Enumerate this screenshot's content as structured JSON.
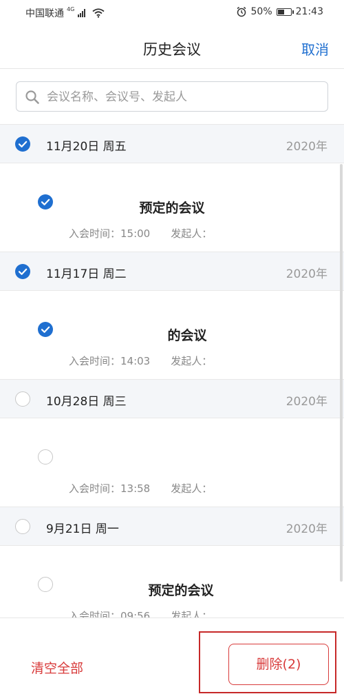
{
  "status_bar": {
    "carrier": "中国联通",
    "network": "4G",
    "battery": "50%",
    "battery_level": 0.5,
    "time": "21:43"
  },
  "header": {
    "title": "历史会议",
    "cancel_label": "取消"
  },
  "search": {
    "placeholder": "会议名称、会议号、发起人",
    "value": ""
  },
  "groups": [
    {
      "date": "11月20日 周五",
      "year": "2020年",
      "checked": true,
      "meeting": {
        "title": "预定的会议",
        "join_time": "入会时间：15:00",
        "initiator": "发起人：",
        "checked": true
      }
    },
    {
      "date": "11月17日 周二",
      "year": "2020年",
      "checked": true,
      "meeting": {
        "title": "的会议",
        "join_time": "入会时间：14:03",
        "initiator": "发起人：",
        "checked": true
      }
    },
    {
      "date": "10月28日 周三",
      "year": "2020年",
      "checked": false,
      "meeting": {
        "title": "",
        "join_time": "入会时间：13:58",
        "initiator": "发起人：",
        "checked": false
      }
    },
    {
      "date": "9月21日 周一",
      "year": "2020年",
      "checked": false,
      "meeting": {
        "title": "预定的会议",
        "join_time": "入会时间：09:56",
        "initiator": "发起人：",
        "checked": false
      }
    }
  ],
  "footer": {
    "clear_all_label": "清空全部",
    "delete_label": "删除(2)"
  },
  "colors": {
    "accent": "#1f6fd0",
    "danger": "#d83a3a",
    "group_bg": "#f4f6f9"
  },
  "icons": {
    "search": "search-icon",
    "checked": "checkmark-circle-icon",
    "unchecked": "empty-circle-icon",
    "alarm": "alarm-clock-icon",
    "wifi": "wifi-icon",
    "battery": "battery-icon",
    "signal": "signal-bars-icon"
  }
}
